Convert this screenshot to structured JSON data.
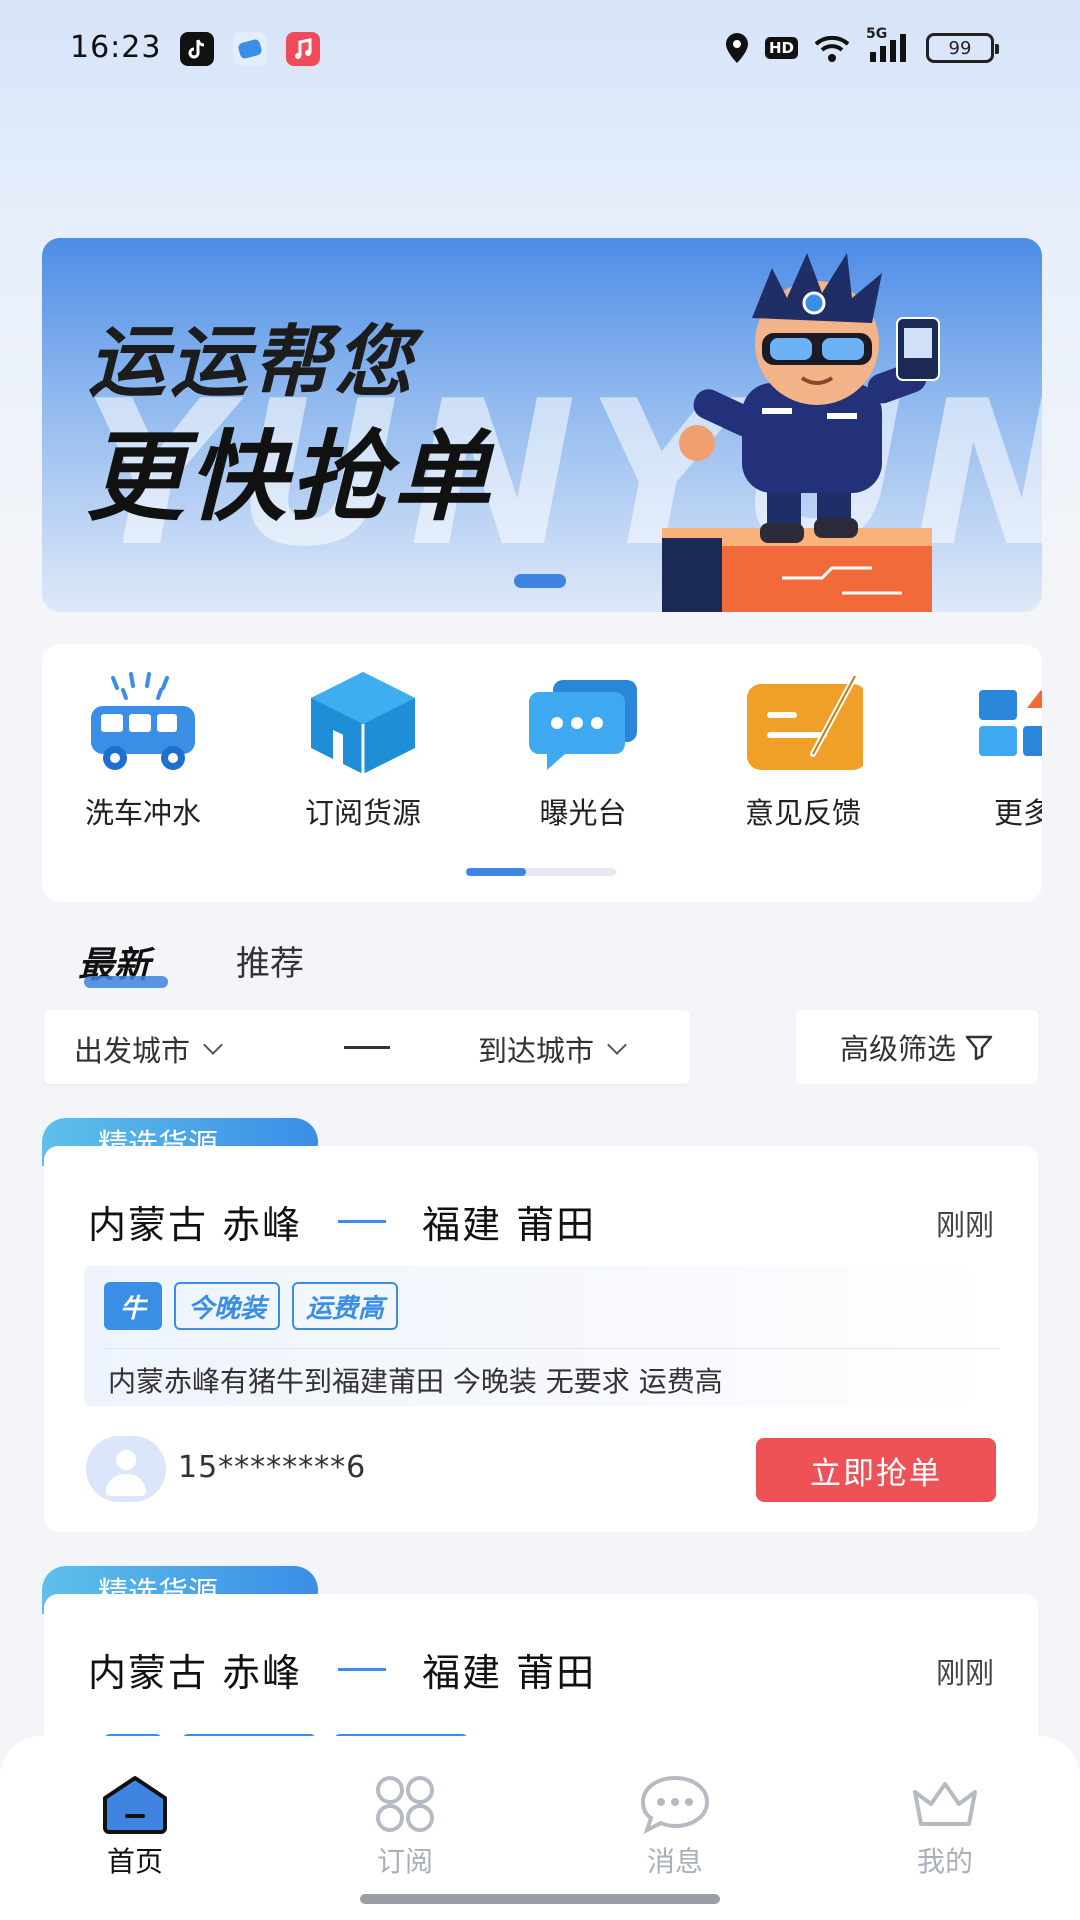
{
  "status_bar": {
    "time": "16:23",
    "battery": "99",
    "icons": [
      "tiktok-icon",
      "app-icon",
      "music-icon",
      "location-icon",
      "hd-icon",
      "wifi-icon",
      "signal-5g-icon",
      "battery-icon"
    ],
    "hd_label": "HD",
    "net_label": "5G"
  },
  "banner": {
    "line1": "运运帮您",
    "line2": "更快抢单",
    "bg_text": "YUNYUN"
  },
  "tools": [
    {
      "label": "洗车冲水",
      "icon": "car-wash-icon"
    },
    {
      "label": "订阅货源",
      "icon": "box-icon"
    },
    {
      "label": "曝光台",
      "icon": "chat-bubbles-icon"
    },
    {
      "label": "意见反馈",
      "icon": "feedback-pen-icon"
    },
    {
      "label": "更多",
      "icon": "more-grid-icon"
    }
  ],
  "tabs": [
    {
      "label": "最新",
      "active": true
    },
    {
      "label": "推荐",
      "active": false
    }
  ],
  "filter": {
    "from_city": "出发城市",
    "to_city": "到达城市",
    "advanced": "高级筛选"
  },
  "cards": [
    {
      "badge": "精选货源",
      "from": "内蒙古 赤峰",
      "to": "福建 莆田",
      "time": "刚刚",
      "tags": [
        "牛",
        "今晚装",
        "运费高"
      ],
      "description": "内蒙赤峰有猪牛到福建莆田 今晚装 无要求 运费高",
      "phone": "15********6",
      "button": "立即抢单"
    },
    {
      "badge": "精选货源",
      "from": "内蒙古 赤峰",
      "to": "福建 莆田",
      "time": "刚刚"
    }
  ],
  "nav": [
    {
      "label": "首页",
      "icon": "home-icon",
      "active": true
    },
    {
      "label": "订阅",
      "icon": "subscribe-grid-icon",
      "active": false
    },
    {
      "label": "消息",
      "icon": "message-icon",
      "active": false
    },
    {
      "label": "我的",
      "icon": "crown-icon",
      "active": false
    }
  ],
  "colors": {
    "accent": "#3e84e0",
    "grab_button": "#ee5257",
    "badge_gradient_start": "#5ec0ea",
    "badge_gradient_end": "#3a8ee6"
  }
}
